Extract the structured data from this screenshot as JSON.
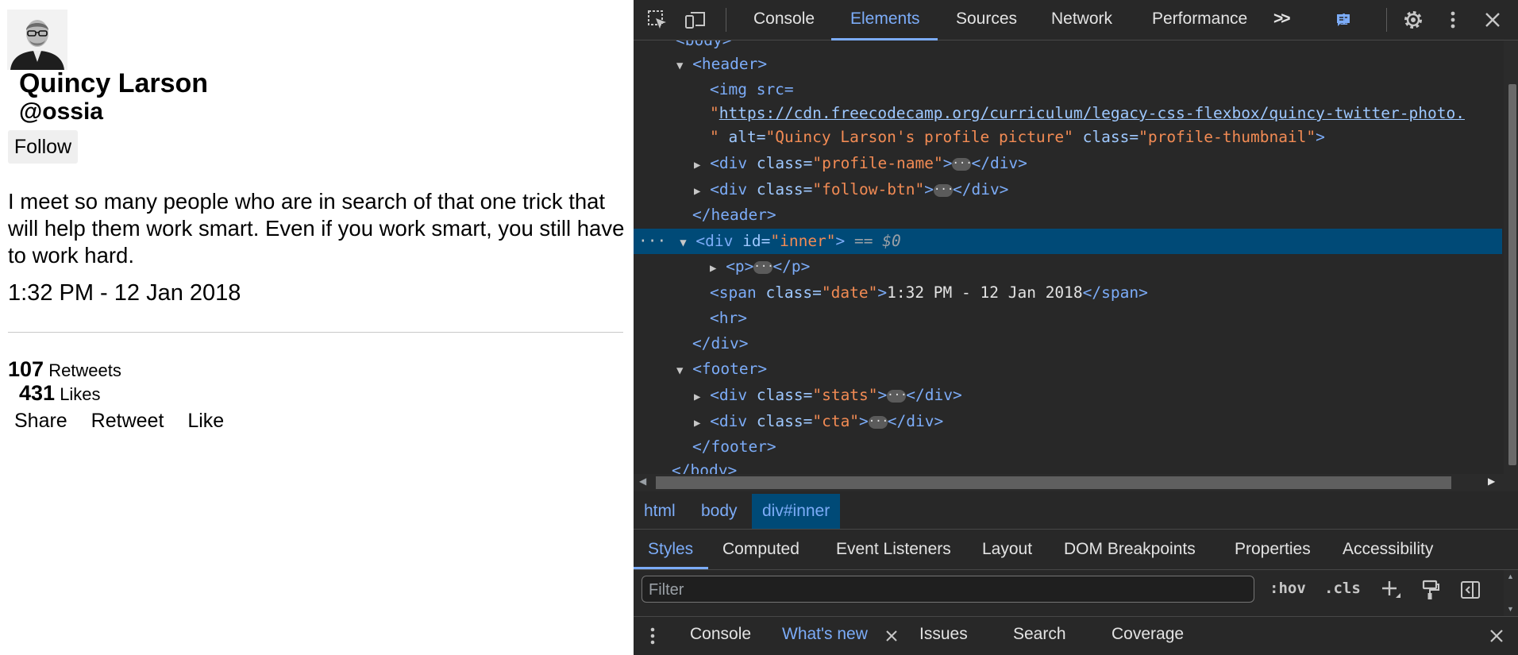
{
  "profile": {
    "avatar_alt": "Quincy Larson's profile picture",
    "name": "Quincy Larson",
    "handle": "@ossia",
    "follow_label": "Follow"
  },
  "tweet": {
    "text": "I meet so many people who are in search of that one trick that will help them work smart. Even if you work smart, you still have to work hard.",
    "date": "1:32 PM - 12 Jan 2018"
  },
  "stats": {
    "retweets_count": "107",
    "retweets_label": "Retweets",
    "likes_count": "431",
    "likes_label": "Likes"
  },
  "cta": {
    "share": "Share",
    "retweet": "Retweet",
    "like": "Like"
  },
  "devtools": {
    "tabs": [
      "Console",
      "Elements",
      "Sources",
      "Network",
      "Performance"
    ],
    "active_tab": "Elements",
    "more_tabs_icon": ">>",
    "message_count": "1",
    "tree": {
      "body_open": "<body>",
      "header_open": "<header>",
      "img_src_attr": "<img src=",
      "img_url": "https://cdn.freecodecamp.org/curriculum/legacy-css-flexbox/quincy-twitter-photo.",
      "img_alt_attr": "alt=",
      "img_alt_val": "\"Quincy Larson's profile picture\"",
      "img_class_attr": "class=",
      "img_class_val": "\"profile-thumbnail\"",
      "div_profile_name": "\"profile-name\"",
      "div_follow_btn": "\"follow-btn\"",
      "header_close": "</header>",
      "div_inner_id": "\"inner\"",
      "dollar0": "== $0",
      "p_tag": "<p>",
      "span_class_val": "\"date\"",
      "span_text": "1:32 PM - 12 Jan 2018",
      "hr": "<hr>",
      "div_close": "</div>",
      "footer_open": "<footer>",
      "div_stats": "\"stats\"",
      "div_cta": "\"cta\"",
      "footer_close": "</footer>",
      "body_close": "</body>"
    },
    "breadcrumbs": [
      "html",
      "body",
      "div#inner"
    ],
    "styles_tabs": [
      "Styles",
      "Computed",
      "Event Listeners",
      "Layout",
      "DOM Breakpoints",
      "Properties",
      "Accessibility"
    ],
    "filter_placeholder": "Filter",
    "hov_label": ":hov",
    "cls_label": ".cls",
    "drawer_tabs": [
      "Console",
      "What's new",
      "Issues",
      "Search",
      "Coverage"
    ],
    "drawer_active": "What's new",
    "colors": {
      "accent": "#7cacf8",
      "selection": "#004a77",
      "attr_value": "#f28b54",
      "bg": "#282828"
    }
  }
}
